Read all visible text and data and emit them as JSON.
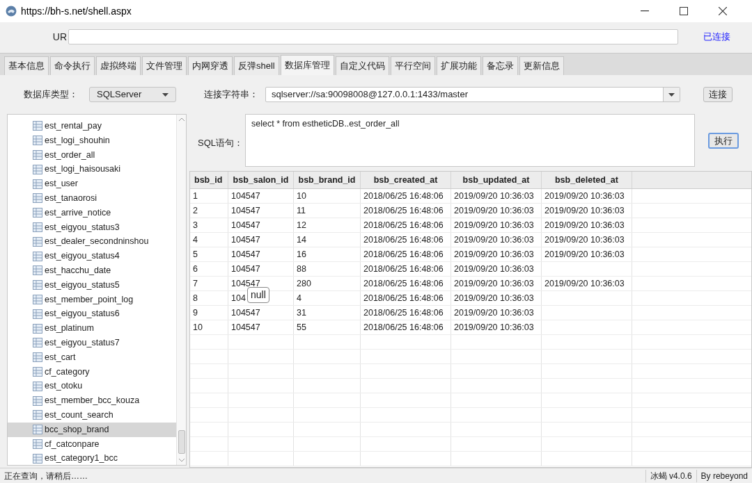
{
  "window": {
    "title": "https://bh-s.net/shell.aspx"
  },
  "url_bar": {
    "label": "UR",
    "status": "已连接"
  },
  "tabs": [
    {
      "label": "基本信息",
      "selected": false
    },
    {
      "label": "命令执行",
      "selected": false
    },
    {
      "label": "虚拟终端",
      "selected": false
    },
    {
      "label": "文件管理",
      "selected": false
    },
    {
      "label": "内网穿透",
      "selected": false
    },
    {
      "label": "反弹shell",
      "selected": false
    },
    {
      "label": "数据库管理",
      "selected": true
    },
    {
      "label": "自定义代码",
      "selected": false
    },
    {
      "label": "平行空间",
      "selected": false
    },
    {
      "label": "扩展功能",
      "selected": false
    },
    {
      "label": "备忘录",
      "selected": false
    },
    {
      "label": "更新信息",
      "selected": false
    }
  ],
  "db_type": {
    "label": "数据库类型：",
    "value": "SQLServer"
  },
  "connection": {
    "label": "连接字符串：",
    "value": "sqlserver://sa:90098008@127.0.0.1:1433/master",
    "button": "连接"
  },
  "tree": {
    "items": [
      {
        "label": "est_rental_pay",
        "selected": false
      },
      {
        "label": "est_logi_shouhin",
        "selected": false
      },
      {
        "label": "est_order_all",
        "selected": false
      },
      {
        "label": "est_logi_haisousaki",
        "selected": false
      },
      {
        "label": "est_user",
        "selected": false
      },
      {
        "label": "est_tanaorosi",
        "selected": false
      },
      {
        "label": "est_arrive_notice",
        "selected": false
      },
      {
        "label": "est_eigyou_status3",
        "selected": false
      },
      {
        "label": "est_dealer_secondninshou",
        "selected": false
      },
      {
        "label": "est_eigyou_status4",
        "selected": false
      },
      {
        "label": "est_hacchu_date",
        "selected": false
      },
      {
        "label": "est_eigyou_status5",
        "selected": false
      },
      {
        "label": "est_member_point_log",
        "selected": false
      },
      {
        "label": "est_eigyou_status6",
        "selected": false
      },
      {
        "label": "est_platinum",
        "selected": false
      },
      {
        "label": "est_eigyou_status7",
        "selected": false
      },
      {
        "label": "est_cart",
        "selected": false
      },
      {
        "label": "cf_category",
        "selected": false
      },
      {
        "label": "est_otoku",
        "selected": false
      },
      {
        "label": "est_member_bcc_kouza",
        "selected": false
      },
      {
        "label": "est_count_search",
        "selected": false
      },
      {
        "label": "bcc_shop_brand",
        "selected": true
      },
      {
        "label": "cf_catconpare",
        "selected": false
      },
      {
        "label": "est_category1_bcc",
        "selected": false
      }
    ]
  },
  "sql": {
    "label": "SQL语句：",
    "query": "select * from estheticDB..est_order_all",
    "button": "执行"
  },
  "table": {
    "columns": [
      "bsb_id",
      "bsb_salon_id",
      "bsb_brand_id",
      "bsb_created_at",
      "bsb_updated_at",
      "bsb_deleted_at"
    ],
    "rows": [
      [
        "1",
        "104547",
        "10",
        "2018/06/25 16:48:06",
        "2019/09/20 10:36:03",
        "2019/09/20 10:36:03"
      ],
      [
        "2",
        "104547",
        "11",
        "2018/06/25 16:48:06",
        "2019/09/20 10:36:03",
        "2019/09/20 10:36:03"
      ],
      [
        "3",
        "104547",
        "12",
        "2018/06/25 16:48:06",
        "2019/09/20 10:36:03",
        "2019/09/20 10:36:03"
      ],
      [
        "4",
        "104547",
        "14",
        "2018/06/25 16:48:06",
        "2019/09/20 10:36:03",
        "2019/09/20 10:36:03"
      ],
      [
        "5",
        "104547",
        "16",
        "2018/06/25 16:48:06",
        "2019/09/20 10:36:03",
        "2019/09/20 10:36:03"
      ],
      [
        "6",
        "104547",
        "88",
        "2018/06/25 16:48:06",
        "2019/09/20 10:36:03",
        ""
      ],
      [
        "7",
        "104547",
        "280",
        "2018/06/25 16:48:06",
        "2019/09/20 10:36:03",
        "2019/09/20 10:36:03"
      ],
      [
        "8",
        "104",
        "4",
        "2018/06/25 16:48:06",
        "2019/09/20 10:36:03",
        ""
      ],
      [
        "9",
        "104547",
        "31",
        "2018/06/25 16:48:06",
        "2019/09/20 10:36:03",
        ""
      ],
      [
        "10",
        "104547",
        "55",
        "2018/06/25 16:48:06",
        "2019/09/20 10:36:03",
        ""
      ]
    ],
    "tooltip": "null"
  },
  "status_bar": {
    "message": "正在查询，请稍后……",
    "version": "冰蝎 v4.0.6",
    "author": "By rebeyond"
  }
}
